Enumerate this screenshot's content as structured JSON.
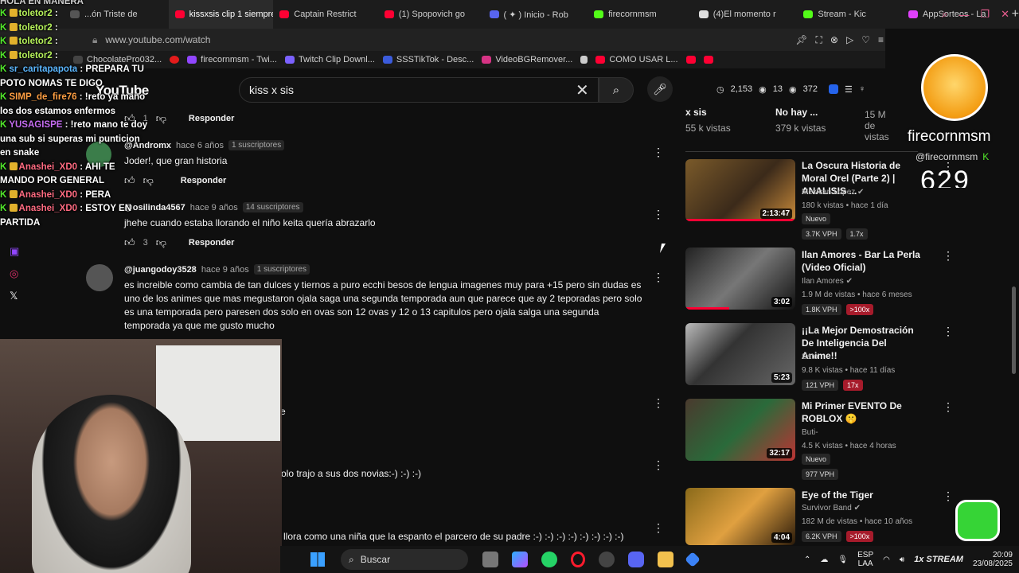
{
  "browser": {
    "tabs": [
      {
        "label": "...ón Triste de",
        "icon_color": "#555555"
      },
      {
        "label": "kissxsis clip 1 siempre he",
        "icon_color": "#ff0033"
      },
      {
        "label": "Captain Restrict",
        "icon_color": "#ff0033"
      },
      {
        "label": "(1) Spopovich go",
        "icon_color": "#ff0033"
      },
      {
        "label": "( ✦ ) Inicio - Rob",
        "icon_color": "#5865f2"
      },
      {
        "label": "firecornmsm",
        "icon_color": "#53fc18"
      },
      {
        "label": "(4)El momento r",
        "icon_color": "#dddddd"
      },
      {
        "label": "Stream - Kic",
        "icon_color": "#53fc18"
      },
      {
        "label": "AppSorteos - La",
        "icon_color": "#e040fb"
      }
    ],
    "new_tab": "+",
    "url": "www.youtube.com/watch",
    "bookmarks": [
      {
        "label": "ChocolatePro032...",
        "icon_color": "#444444"
      },
      {
        "label": "",
        "icon_color": "#e41b1b"
      },
      {
        "label": "firecornmsm - Twi...",
        "icon_color": "#9146ff"
      },
      {
        "label": "Twitch Clip Downl...",
        "icon_color": "#7b61ff"
      },
      {
        "label": "SSSTikTok - Desc...",
        "icon_color": "#3b5bdb"
      },
      {
        "label": "VideoBGRemover...",
        "icon_color": "#d63384"
      },
      {
        "label": "",
        "icon_color": "#cccccc"
      },
      {
        "label": "COMO USAR L...",
        "icon_color": "#ff0033"
      },
      {
        "label": "",
        "icon_color": "#ff0033"
      },
      {
        "label": "",
        "icon_color": "#ff0033"
      }
    ]
  },
  "youtube": {
    "logo": "YouTube",
    "search_value": "kiss x sis",
    "stats": {
      "views_a": "2,153",
      "views_b": "13",
      "views_c": "372"
    }
  },
  "comments": [
    {
      "reply_label": "Responder",
      "likes": "1"
    },
    {
      "handle": "@Andromx",
      "time": "hace 6 años",
      "badge": "1 suscriptores",
      "text": "Joder!, que gran historia",
      "reply_label": "Responder"
    },
    {
      "handle": "@osilinda4567",
      "time": "hace 9 años",
      "badge": "14 suscriptores",
      "text": "jhehe cuando estaba llorando el niño keita quería abrazarlo",
      "reply_label": "Responder",
      "likes": "3"
    },
    {
      "handle": "@juangodoy3528",
      "time": "hace 9 años",
      "badge": "1 suscriptores",
      "text": "es increible como cambia de tan dulces y tiernos a puro ecchi besos de lengua imagenes muy para +15 pero sin dudas es uno de los animes que mas megustaron ojala saga una segunda temporada aun que parece que ay 2 teporadas pero solo es una temporada pero paresen dos solo en ovas son 12 ovas y 12 o 13 capitulos pero ojala salga una segunda temporada ya que me gusto mucho"
    },
    {
      "text": "e"
    },
    {
      "text": "olo trajo a sus dos novias:-) :-) :-)"
    },
    {
      "text": "llora como una niña que la espanto el parcero de su padre :-) :-) :-) :-) :-) :-) :-) :-)"
    }
  ],
  "top_recs": [
    {
      "title": "x sis",
      "meta": "55 k vistas"
    },
    {
      "title": "No hay ...",
      "meta": "379 k vistas"
    },
    {
      "meta": "15 M de vistas"
    }
  ],
  "recommendations": [
    {
      "title": "La Oscura Historia de Moral Orel (Parte 2) | ANALISIS ...",
      "channel": "Mexican Lopez",
      "meta": "180 k vistas • hace 1 día",
      "duration": "2:13:47",
      "tag": "Nuevo",
      "vph": "3.7K VPH",
      "mult": "1.7x",
      "mult_hot": false
    },
    {
      "title": "Ilan Amores - Bar La Perla (Video Oficial)",
      "channel": "Ilan Amores",
      "meta": "1.9 M de vistas • hace 6 meses",
      "duration": "3:02",
      "tag": "",
      "vph": "1.8K VPH",
      "mult": ">100x",
      "mult_hot": true
    },
    {
      "title": "¡¡La Mejor Demostración De Inteligencia Del Anime!!",
      "channel": "Sato",
      "meta": "9.8 K vistas • hace 11 días",
      "duration": "5:23",
      "tag": "",
      "vph": "121 VPH",
      "mult": "17x",
      "mult_hot": true
    },
    {
      "title": "Mi Primer EVENTO De ROBLOX 🤫",
      "channel": "Buti-",
      "meta": "4.5 K vistas • hace 4 horas",
      "duration": "32:17",
      "tag": "Nuevo",
      "vph": "977 VPH",
      "mult": "",
      "mult_hot": false
    },
    {
      "title": "Eye of the Tiger",
      "channel": "Survivor Band",
      "meta": "182 M de vistas • hace 10 años",
      "duration": "4:04",
      "tag": "",
      "vph": "6.2K VPH",
      "mult": ">100x",
      "mult_hot": true
    }
  ],
  "overlay": {
    "streamer_name": "firecornmsm",
    "streamer_handle": "@firecornmsm",
    "counter": "629"
  },
  "chat": [
    {
      "user": "toletor2",
      "msg": ":"
    },
    {
      "user": "toletor2",
      "msg": ":"
    },
    {
      "user": "toletor2",
      "msg": ":"
    },
    {
      "user": "toletor2",
      "msg": ":"
    },
    {
      "user": "sr_caritapapota",
      "msg": ": PREPARA TU POTO NOMAS TE DIGO"
    },
    {
      "user": "SIMP_de_fire76",
      "msg": ": !reto ya mano los dos estamos enfermos"
    },
    {
      "user": "YUSAGISPE",
      "msg": ": !reto mano te doy una sub si superas mi punticion en snake"
    },
    {
      "user": "Anashei_XD0",
      "msg": ": AHI TE MANDO POR GENERAL"
    },
    {
      "user": "Anashei_XD0",
      "msg": ": PERA"
    },
    {
      "user": "Anashei_XD0",
      "msg": ": ESTOY EN PARTIDA"
    }
  ],
  "chat_header": "HOLA EN MANERA",
  "taskbar": {
    "search_label": "Buscar",
    "lang": "ESP",
    "lang2": "LAA",
    "time": "20:09",
    "date": "23/08/2025",
    "brand": "1x STREAM"
  },
  "colors": {
    "accent_red": "#ff0033",
    "kick_green": "#53fc18",
    "hot_pill": "#a61b2b"
  }
}
